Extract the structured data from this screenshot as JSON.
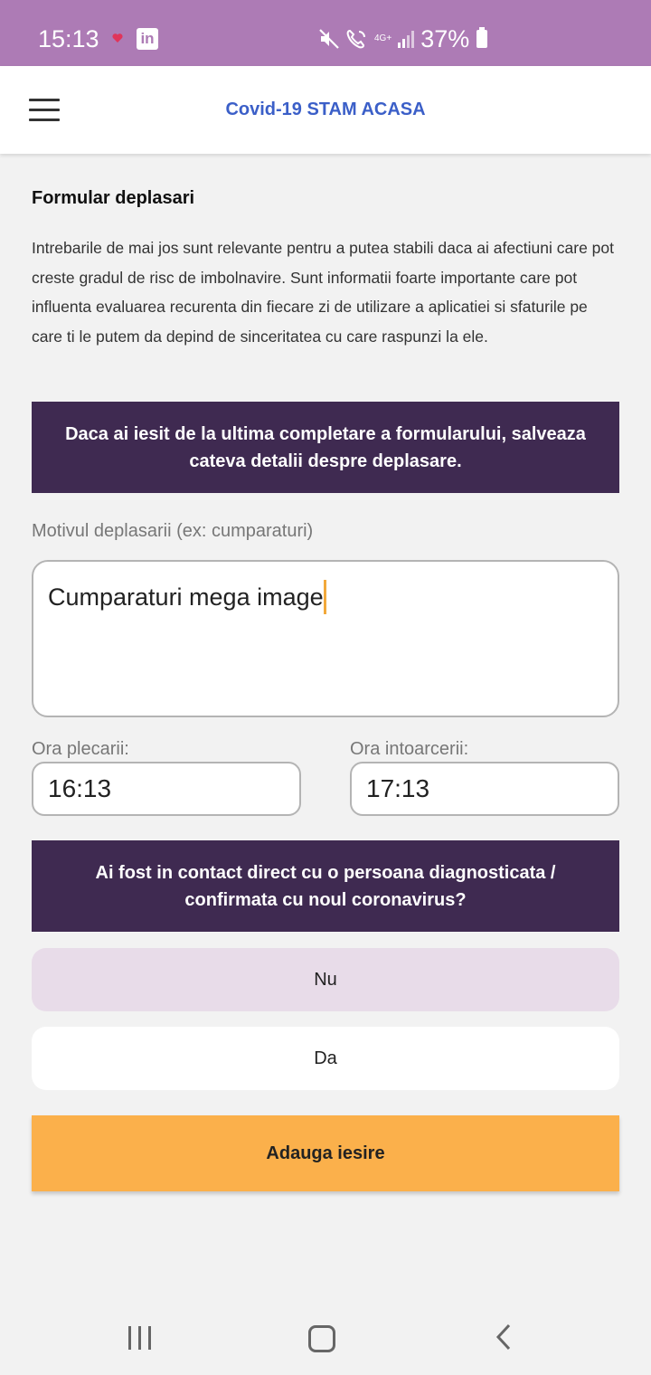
{
  "status_bar": {
    "time": "15:13",
    "network": "4G+",
    "battery": "37%",
    "icons": [
      "heart-icon",
      "linkedin-icon",
      "mute-icon",
      "wifi-call-icon",
      "signal-icon",
      "battery-icon"
    ],
    "linkedin_text": "in"
  },
  "app_bar": {
    "title": "Covid-19 STAM ACASA",
    "menu_icon": "hamburger-menu-icon"
  },
  "form": {
    "heading": "Formular deplasari",
    "intro": "Intrebarile de mai jos sunt relevante pentru a putea stabili daca ai afectiuni care pot creste gradul de risc de imbolnavire. Sunt informatii foarte importante care pot influenta evaluarea recurenta din fiecare zi de utilizare a aplicatiei si sfaturile pe care ti le putem da depind de sinceritatea cu care raspunzi la ele.",
    "banner_trip": "Daca ai iesit de la ultima completare a formularului, salveaza cateva detalii despre deplasare.",
    "reason_label": "Motivul deplasarii (ex: cumparaturi)",
    "reason_value": "Cumparaturi mega image",
    "departure_label": "Ora plecarii:",
    "departure_value": "16:13",
    "return_label": "Ora intoarcerii:",
    "return_value": "17:13",
    "banner_contact": "Ai fost in contact direct cu o persoana diagnosticata / confirmata cu noul coronavirus?",
    "option_no": "Nu",
    "option_yes": "Da",
    "selected_option": "Nu",
    "submit_label": "Adauga iesire"
  },
  "nav_bar": {
    "icons": [
      "recents-icon",
      "home-icon",
      "back-icon"
    ]
  },
  "colors": {
    "status_bar": "#ad7bb5",
    "title": "#3b5fc8",
    "banner": "#3f2a51",
    "selected_option": "#e8dce9",
    "submit": "#fbb04b",
    "caret": "#f2a93b"
  }
}
